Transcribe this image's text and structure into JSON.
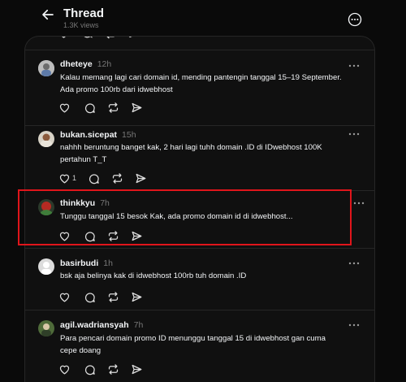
{
  "header": {
    "title": "Thread",
    "views": "1.3K views"
  },
  "posts": [
    {
      "username": "dheteye",
      "time": "12h",
      "lines": [
        "Kalau memang lagi cari domain id, mending pantengin tanggal 15–19 September.",
        "Ada promo 100rb dari idwebhost"
      ],
      "likes": ""
    },
    {
      "username": "bukan.sicepat",
      "time": "15h",
      "lines": [
        "nahhh beruntung banget kak, 2 hari lagi tuhh domain .ID di IDwebhost 100K",
        "pertahun T_T"
      ],
      "likes": "1"
    },
    {
      "username": "thinkkyu",
      "time": "7h",
      "lines": [
        "Tunggu tanggal 15 besok Kak, ada promo domain id di idwebhost..."
      ],
      "likes": ""
    },
    {
      "username": "basirbudi",
      "time": "1h",
      "lines": [
        "bsk aja belinya kak di idwebhost 100rb tuh domain .ID"
      ],
      "likes": ""
    },
    {
      "username": "agil.wadriansyah",
      "time": "7h",
      "lines": [
        "Para pencari domain promo ID menunggu tanggal 15 di idwebhost gan cuma",
        "cepe doang"
      ],
      "likes": ""
    }
  ],
  "icons": [
    "back-arrow-icon",
    "more-circle-icon",
    "heart-icon",
    "comment-icon",
    "repost-icon",
    "share-icon",
    "more-dots-icon"
  ],
  "colors": {
    "background": "#0a0a0a",
    "card": "#101010",
    "text": "#f3f5f7",
    "muted": "#777777",
    "highlight": "#e0151b"
  }
}
